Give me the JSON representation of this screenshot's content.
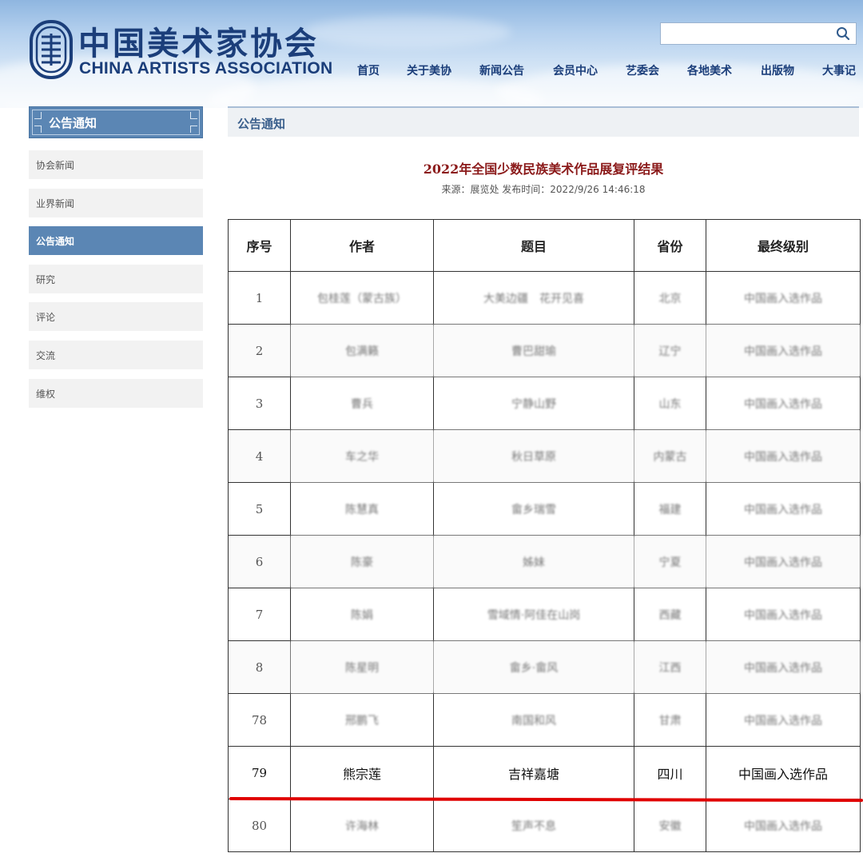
{
  "site": {
    "name_cn": "中国美术家协会",
    "name_en": "CHINA ARTISTS ASSOCIATION",
    "search_placeholder": ""
  },
  "nav": [
    "首页",
    "关于美协",
    "新闻公告",
    "会员中心",
    "艺委会",
    "各地美术",
    "出版物",
    "大事记"
  ],
  "sidebar": {
    "title": "公告通知",
    "items": [
      {
        "label": "协会新闻",
        "active": false
      },
      {
        "label": "业界新闻",
        "active": false
      },
      {
        "label": "公告通知",
        "active": true
      },
      {
        "label": "研究",
        "active": false
      },
      {
        "label": "评论",
        "active": false
      },
      {
        "label": "交流",
        "active": false
      },
      {
        "label": "维权",
        "active": false
      }
    ]
  },
  "main": {
    "section_title": "公告通知",
    "article_title": "2022年全国少数民族美术作品展复评结果",
    "article_meta": "来源：展览处 发布时间：2022/9/26 14:46:18"
  },
  "table": {
    "headers": [
      "序号",
      "作者",
      "题目",
      "省份",
      "最终级别"
    ],
    "rows": [
      [
        "1",
        "包桂莲（蒙古族）",
        "大美边疆　花开见喜",
        "北京",
        "中国画入选作品"
      ],
      [
        "2",
        "包满籁",
        "曹巴甜瑜",
        "辽宁",
        "中国画入选作品"
      ],
      [
        "3",
        "曹兵",
        "宁静山野",
        "山东",
        "中国画入选作品"
      ],
      [
        "4",
        "车之华",
        "秋日草原",
        "内蒙古",
        "中国画入选作品"
      ],
      [
        "5",
        "陈慧真",
        "畲乡瑞雪",
        "福建",
        "中国画入选作品"
      ],
      [
        "6",
        "陈豪",
        "姊妹",
        "宁夏",
        "中国画入选作品"
      ],
      [
        "7",
        "陈娟",
        "雪域情·阿佳在山岗",
        "西藏",
        "中国画入选作品"
      ],
      [
        "8",
        "陈星明",
        "畲乡·畲风",
        "江西",
        "中国画入选作品"
      ],
      [
        "78",
        "邢鹏飞",
        "南国和风",
        "甘肃",
        "中国画入选作品"
      ],
      [
        "79",
        "熊宗莲",
        "吉祥嘉塘",
        "四川",
        "中国画入选作品"
      ],
      [
        "80",
        "许海林",
        "笙声不息",
        "安徽",
        "中国画入选作品"
      ]
    ],
    "highlighted_row": 9,
    "highlight_color": "#e00000"
  }
}
